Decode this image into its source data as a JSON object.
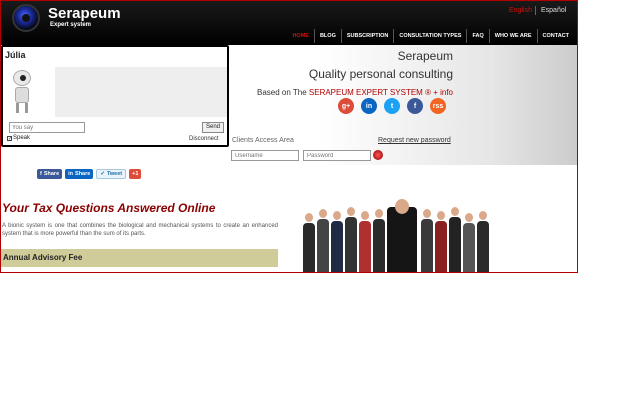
{
  "header": {
    "brand": "Serapeum",
    "tagline": "Expert system",
    "languages": {
      "english": "English",
      "spanish": "Español"
    },
    "nav": [
      "HOME",
      "BLOG",
      "SUBSCRIPTION",
      "CONSULTATION TYPES",
      "FAQ",
      "WHO WE ARE",
      "CONTACT"
    ],
    "active_nav": "HOME",
    "accent_color": "#d01010"
  },
  "hero": {
    "title": "Serapeum",
    "subtitle": "Quality personal consulting",
    "based_prefix": "Based on The ",
    "based_highlight": "SERAPEUM EXPERT SYSTEM ®",
    "based_link": " + info",
    "social_icons": [
      "google-plus-icon",
      "linkedin-icon",
      "twitter-icon",
      "facebook-icon",
      "rss-icon"
    ],
    "social_labels": [
      "g+",
      "in",
      "t",
      "f",
      "rss"
    ]
  },
  "login": {
    "label": "Clients Access Area",
    "request_password": "Request new password",
    "username_placeholder": "Username",
    "password_placeholder": "Password"
  },
  "chat": {
    "agent_name": "Júlia",
    "input_placeholder": "You say",
    "send_label": "Send",
    "speak_label": "Speak",
    "speak_checked": true,
    "disconnect_label": "Disconnect"
  },
  "share": {
    "facebook": "Share",
    "linkedin": "Share",
    "twitter": "Tweet",
    "google": "+1"
  },
  "content": {
    "title": "Your Tax Questions Answered Online",
    "text": "A bionic system is one that combines the biological and mechanical systems to create an enhanced system that is more powerful than the sum of its parts.",
    "fee_title": "Annual Advisory Fee"
  }
}
